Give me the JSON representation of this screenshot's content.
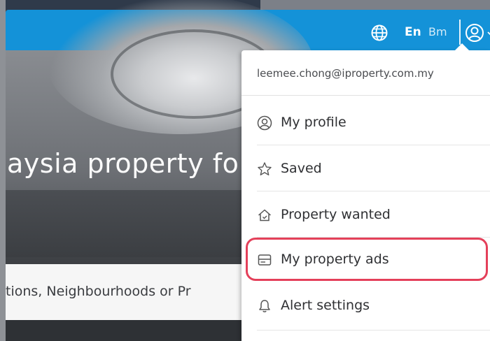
{
  "header": {
    "lang_en": "En",
    "lang_bm": "Bm",
    "icons": [
      "globe-icon",
      "user-icon",
      "chevron-down-icon"
    ],
    "color": "#1492d8"
  },
  "hero": {
    "title": "aysia property fo",
    "search_placeholder": "tions, Neighbourhoods or Pr"
  },
  "dropdown": {
    "email": "leemee.chong@iproperty.com.my",
    "items": [
      {
        "label": "My profile",
        "icon": "user-circle-icon"
      },
      {
        "label": "Saved",
        "icon": "star-icon"
      },
      {
        "label": "Property wanted",
        "icon": "house-icon"
      },
      {
        "label": "My property ads",
        "icon": "listing-icon",
        "highlighted": true
      },
      {
        "label": "Alert settings",
        "icon": "bell-icon"
      }
    ],
    "highlight_color": "#e4405a"
  }
}
